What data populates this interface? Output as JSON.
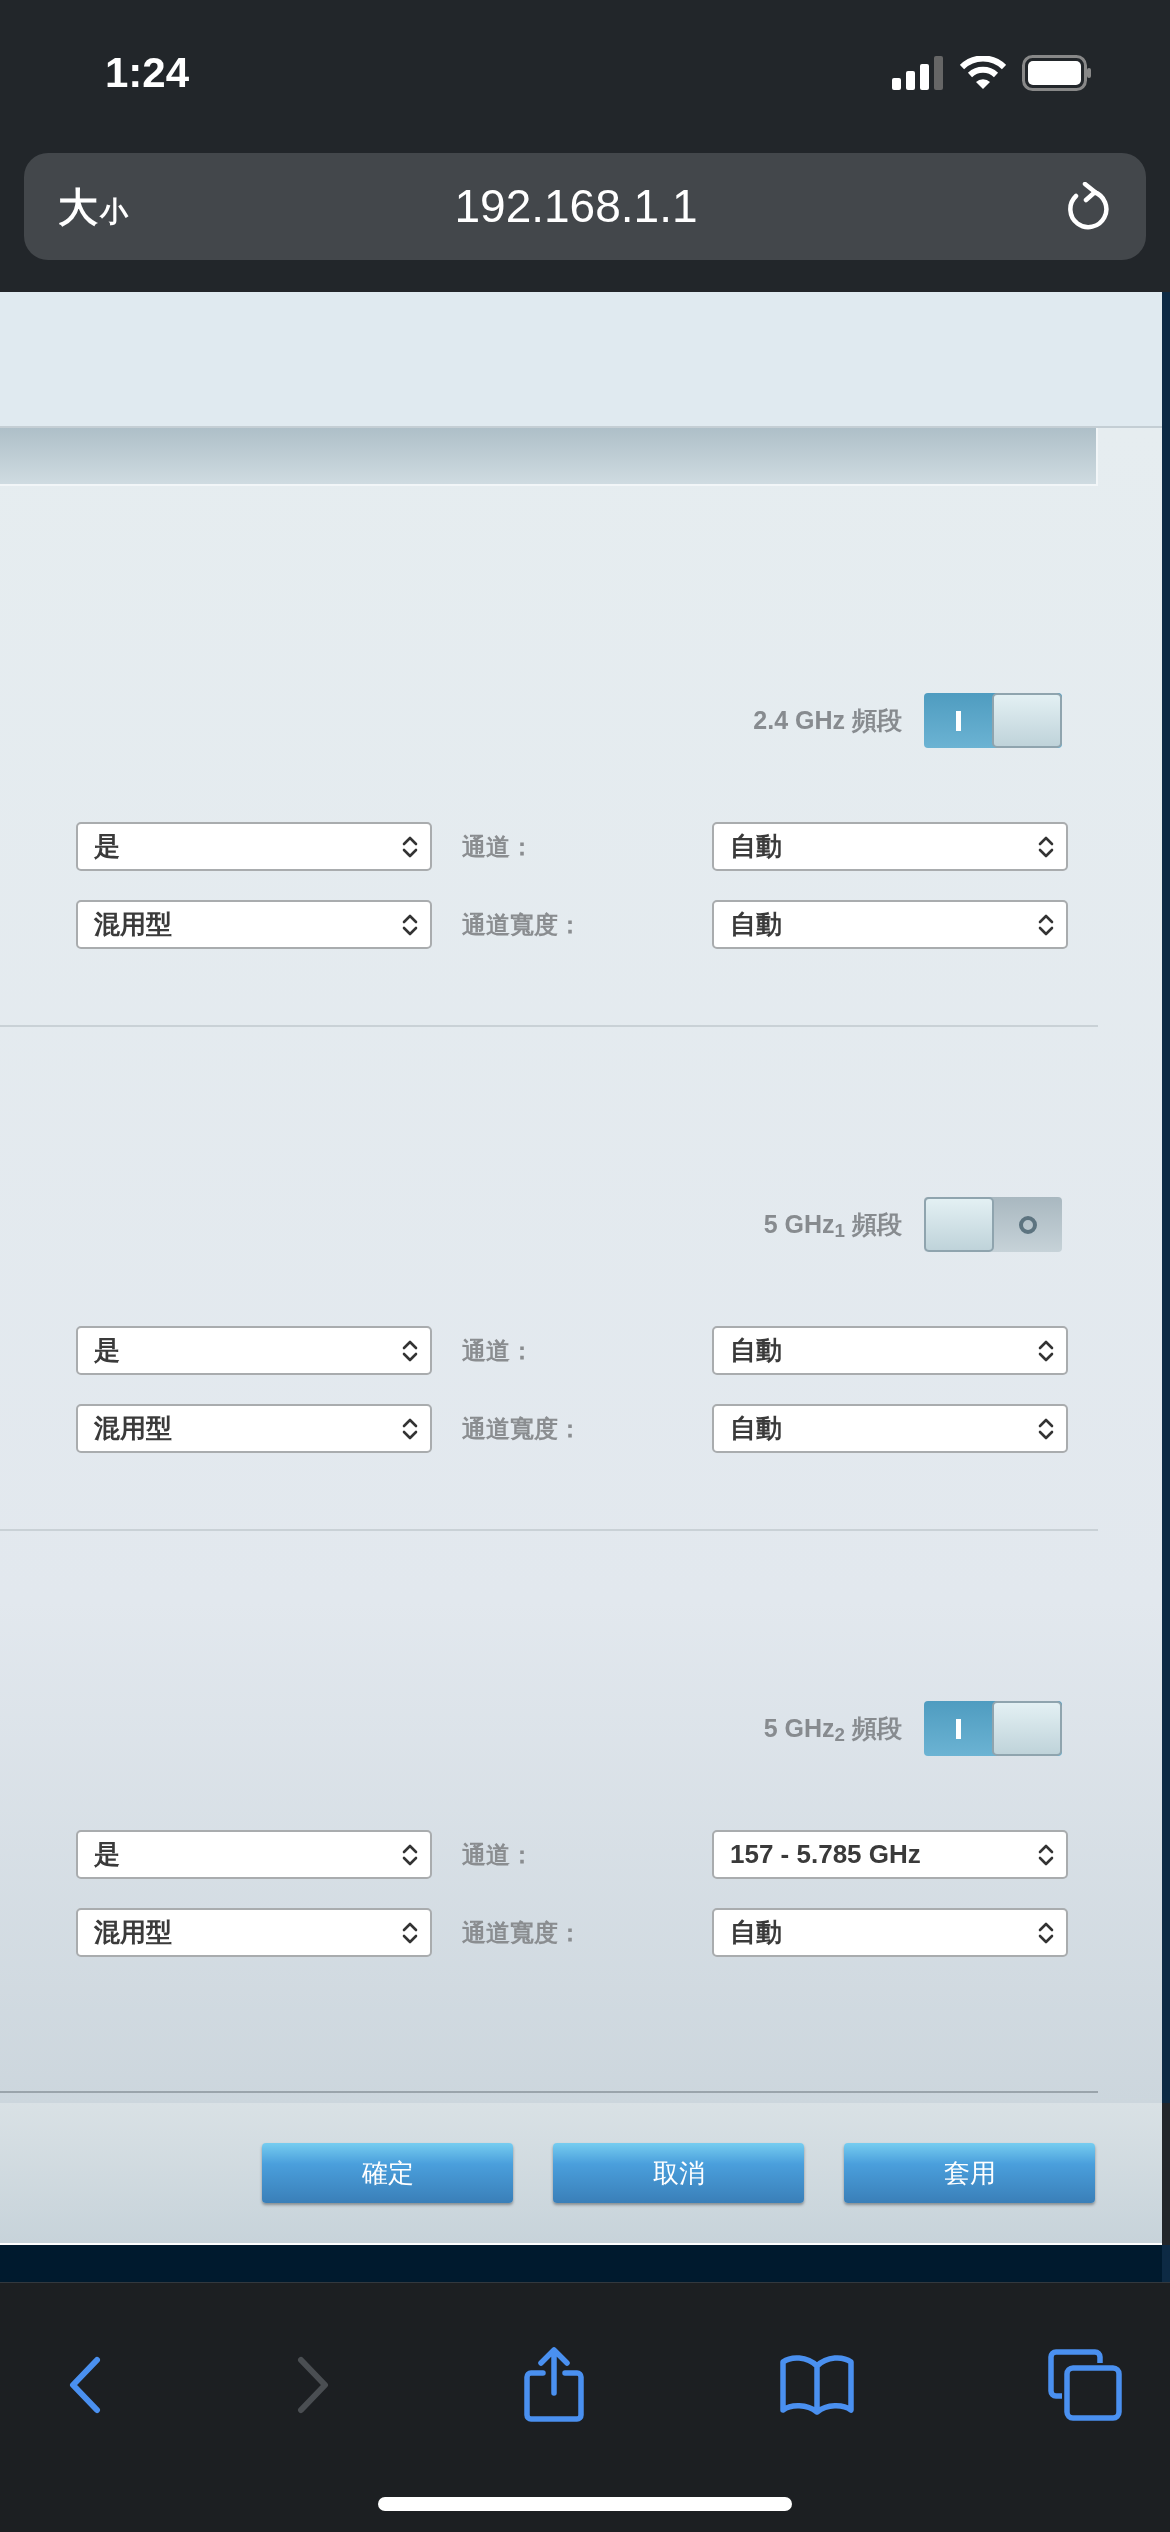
{
  "status_bar": {
    "time": "1:24"
  },
  "address_bar": {
    "text_size": {
      "large": "大",
      "small": "小"
    },
    "url": "192.168.1.1"
  },
  "bands": [
    {
      "label": "2.4 GHz 頻段",
      "on": true,
      "rows": [
        {
          "left_value": "是",
          "label": "通道：",
          "right_value": "自動"
        },
        {
          "left_value": "混用型",
          "label": "通道寬度：",
          "right_value": "自動"
        }
      ]
    },
    {
      "label": "5 GHz$_{1}$ 頻段",
      "on": false,
      "rows": [
        {
          "left_value": "是",
          "label": "通道：",
          "right_value": "自動"
        },
        {
          "left_value": "混用型",
          "label": "通道寬度：",
          "right_value": "自動"
        }
      ]
    },
    {
      "label": "5 GHz$_{2}$ 頻段",
      "on": true,
      "rows": [
        {
          "left_value": "是",
          "label": "通道：",
          "right_value": "157 - 5.785 GHz"
        },
        {
          "left_value": "混用型",
          "label": "通道寬度：",
          "right_value": "自動"
        }
      ]
    }
  ],
  "buttons": [
    "確定",
    "取消",
    "套用"
  ],
  "toolbar": {
    "back_enabled": true,
    "forward_enabled": false
  }
}
